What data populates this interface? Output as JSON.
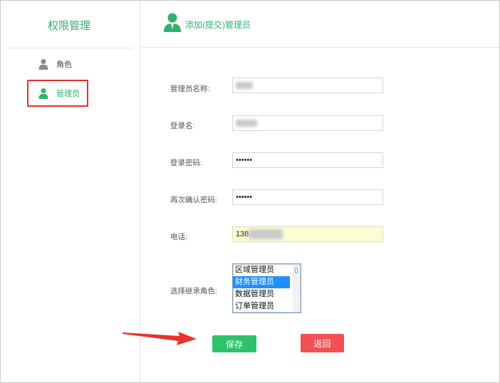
{
  "sidebar": {
    "title": "权限管理",
    "items": [
      {
        "label": "角色",
        "icon": "user-icon",
        "active": false
      },
      {
        "label": "管理员",
        "icon": "user-icon",
        "active": true
      }
    ]
  },
  "header": {
    "icon": "admin-user-icon",
    "title": "添加(提交)管理员"
  },
  "form": {
    "name_label": "管理员名称:",
    "name_value": "",
    "login_label": "登录名:",
    "login_value": "",
    "password_label": "登录密码:",
    "password_value": "••••••",
    "confirm_label": "再次确认密码:",
    "confirm_value": "••••••",
    "phone_label": "电话:",
    "phone_value": "138",
    "role_label": "选择继承角色:",
    "role_options": [
      "区域管理员",
      "财务管理员",
      "数据管理员",
      "订单管理员"
    ],
    "role_selected": "财务管理员"
  },
  "buttons": {
    "save_label": "保存",
    "back_label": "返回"
  },
  "colors": {
    "accent_green": "#2db36b",
    "save_green": "#2fc26a",
    "back_red": "#f25054",
    "annotation_red": "#e0332e",
    "select_blue": "#1e90ff"
  }
}
